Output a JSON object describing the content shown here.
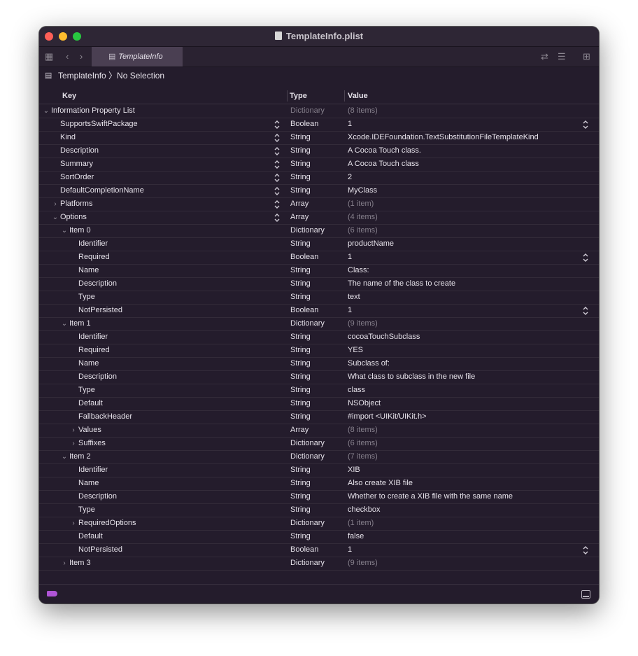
{
  "window": {
    "title": "TemplateInfo.plist"
  },
  "toolbar": {
    "tab_label": "TemplateInfo"
  },
  "jumpbar": {
    "path": "TemplateInfo 〉No Selection"
  },
  "columns": {
    "key": "Key",
    "type": "Type",
    "value": "Value"
  },
  "rows": [
    {
      "key": "Information Property List",
      "type": "Dictionary",
      "value": "(8 items)",
      "level": 0,
      "disclosure": "open"
    },
    {
      "key": "SupportsSwiftPackage",
      "type": "Boolean",
      "value": "1",
      "level": 1,
      "key_stepper": true,
      "value_stepper": true
    },
    {
      "key": "Kind",
      "type": "String",
      "value": "Xcode.IDEFoundation.TextSubstitutionFileTemplateKind",
      "level": 1,
      "key_stepper": true
    },
    {
      "key": "Description",
      "type": "String",
      "value": "A Cocoa Touch class.",
      "level": 1,
      "key_stepper": true
    },
    {
      "key": "Summary",
      "type": "String",
      "value": "A Cocoa Touch class",
      "level": 1,
      "key_stepper": true
    },
    {
      "key": "SortOrder",
      "type": "String",
      "value": "2",
      "level": 1,
      "key_stepper": true
    },
    {
      "key": "DefaultCompletionName",
      "type": "String",
      "value": "MyClass",
      "level": 1,
      "key_stepper": true
    },
    {
      "key": "Platforms",
      "type": "Array",
      "value": "(1 item)",
      "level": 1,
      "disclosure": "closed",
      "key_stepper": true
    },
    {
      "key": "Options",
      "type": "Array",
      "value": "(4 items)",
      "level": 1,
      "disclosure": "open",
      "key_stepper": true
    },
    {
      "key": "Item 0",
      "type": "Dictionary",
      "value": "(6 items)",
      "level": 2,
      "disclosure": "open"
    },
    {
      "key": "Identifier",
      "type": "String",
      "value": "productName",
      "level": 3
    },
    {
      "key": "Required",
      "type": "Boolean",
      "value": "1",
      "level": 3,
      "value_stepper": true
    },
    {
      "key": "Name",
      "type": "String",
      "value": "Class:",
      "level": 3
    },
    {
      "key": "Description",
      "type": "String",
      "value": "The name of the class to create",
      "level": 3
    },
    {
      "key": "Type",
      "type": "String",
      "value": "text",
      "level": 3
    },
    {
      "key": "NotPersisted",
      "type": "Boolean",
      "value": "1",
      "level": 3,
      "value_stepper": true
    },
    {
      "key": "Item 1",
      "type": "Dictionary",
      "value": "(9 items)",
      "level": 2,
      "disclosure": "open"
    },
    {
      "key": "Identifier",
      "type": "String",
      "value": "cocoaTouchSubclass",
      "level": 3
    },
    {
      "key": "Required",
      "type": "String",
      "value": "YES",
      "level": 3
    },
    {
      "key": "Name",
      "type": "String",
      "value": "Subclass of:",
      "level": 3
    },
    {
      "key": "Description",
      "type": "String",
      "value": "What class to subclass in the new file",
      "level": 3
    },
    {
      "key": "Type",
      "type": "String",
      "value": "class",
      "level": 3
    },
    {
      "key": "Default",
      "type": "String",
      "value": "NSObject",
      "level": 3
    },
    {
      "key": "FallbackHeader",
      "type": "String",
      "value": "#import <UIKit/UIKit.h>",
      "level": 3
    },
    {
      "key": "Values",
      "type": "Array",
      "value": "(8 items)",
      "level": 3,
      "disclosure": "closed"
    },
    {
      "key": "Suffixes",
      "type": "Dictionary",
      "value": "(6 items)",
      "level": 3,
      "disclosure": "closed"
    },
    {
      "key": "Item 2",
      "type": "Dictionary",
      "value": "(7 items)",
      "level": 2,
      "disclosure": "open"
    },
    {
      "key": "Identifier",
      "type": "String",
      "value": "XIB",
      "level": 3
    },
    {
      "key": "Name",
      "type": "String",
      "value": "Also create XIB file",
      "level": 3
    },
    {
      "key": "Description",
      "type": "String",
      "value": "Whether to create a XIB file with the same name",
      "level": 3
    },
    {
      "key": "Type",
      "type": "String",
      "value": "checkbox",
      "level": 3
    },
    {
      "key": "RequiredOptions",
      "type": "Dictionary",
      "value": "(1 item)",
      "level": 3,
      "disclosure": "closed"
    },
    {
      "key": "Default",
      "type": "String",
      "value": "false",
      "level": 3
    },
    {
      "key": "NotPersisted",
      "type": "Boolean",
      "value": "1",
      "level": 3,
      "value_stepper": true
    },
    {
      "key": "Item 3",
      "type": "Dictionary",
      "value": "(9 items)",
      "level": 2,
      "disclosure": "closed"
    }
  ],
  "colors": {
    "window_bg": "#241c2c",
    "tab_bg": "#4a3f52",
    "tag": "#b054d6",
    "close": "#fe5f57",
    "minimize": "#febc2e",
    "zoom": "#28c840"
  }
}
